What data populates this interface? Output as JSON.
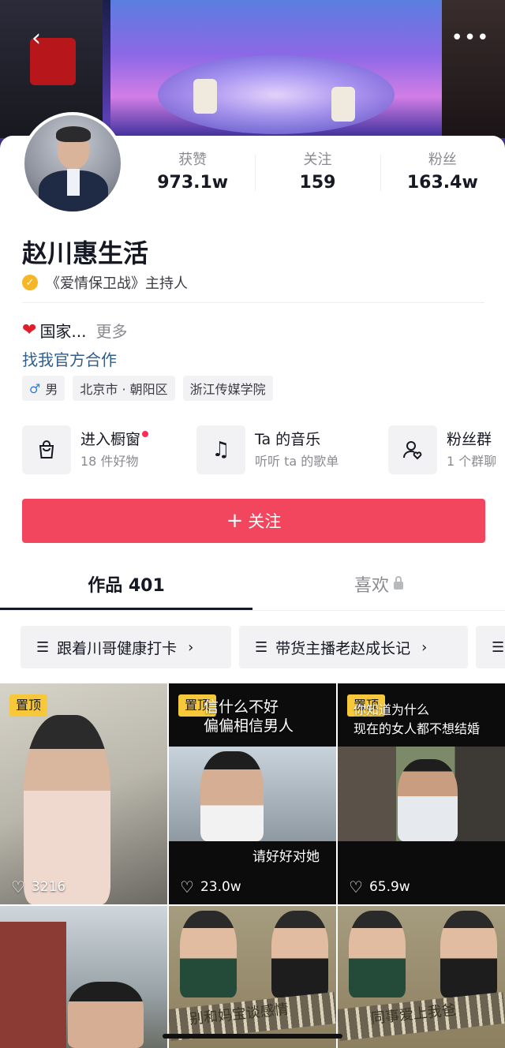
{
  "stats": [
    {
      "label": "获赞",
      "value": "973.1w"
    },
    {
      "label": "关注",
      "value": "159"
    },
    {
      "label": "粉丝",
      "value": "163.4w"
    }
  ],
  "profile": {
    "name": "赵川惠生活",
    "verification": "《爱情保卫战》主持人",
    "bio": "国家...",
    "bio_more": "更多",
    "coop_link": "找我官方合作"
  },
  "tags": [
    "男",
    "北京市 · 朝阳区",
    "浙江传媒学院"
  ],
  "entries": [
    {
      "title": "进入橱窗",
      "sub": "18 件好物",
      "icon": "shopping-bag-icon"
    },
    {
      "title": "Ta 的音乐",
      "sub": "听听 ta 的歌单",
      "icon": "music-note-icon"
    },
    {
      "title": "粉丝群",
      "sub": "1 个群聊",
      "icon": "fan-group-icon"
    }
  ],
  "follow_button": "关注",
  "tabs": {
    "works": "作品 401",
    "likes": "喜欢"
  },
  "collections": [
    "跟着川哥健康打卡",
    "带货主播老赵成长记"
  ],
  "videos": [
    {
      "pin": "置顶",
      "caption": "",
      "plays": "3216"
    },
    {
      "pin": "置顶",
      "caption_top": "信什么不好\n偏偏相信男人",
      "caption_bottom": "请好好对她",
      "plays": "23.0w"
    },
    {
      "pin": "置顶",
      "caption_top": "你知道为什么\n现在的女人都不想结婚",
      "plays": "65.9w"
    },
    {
      "caption": ""
    },
    {
      "caption_bottom": "别和妈宝谈感情"
    },
    {
      "caption_bottom": "同事爱上我爸"
    }
  ],
  "colors": {
    "accent": "#f2465f",
    "pin": "#f7c83a",
    "link": "#2f5e8c",
    "verify": "#f6b626"
  }
}
